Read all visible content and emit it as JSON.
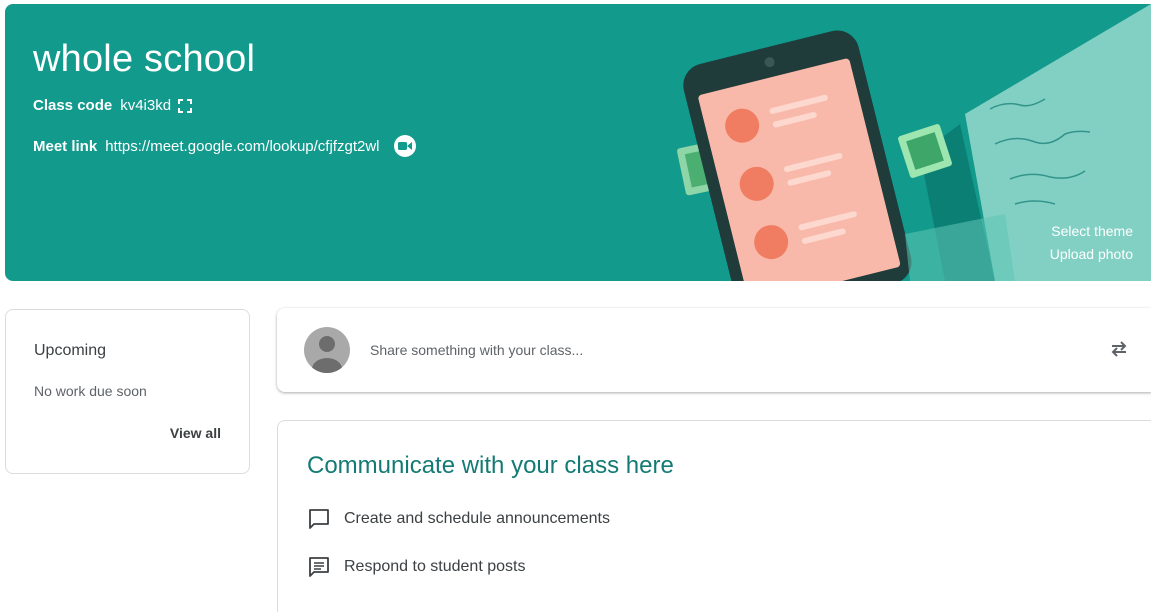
{
  "banner": {
    "title": "whole school",
    "class_code_label": "Class code",
    "class_code_value": "kv4i3kd",
    "meet_link_label": "Meet link",
    "meet_link_value": "https://meet.google.com/lookup/cfjfzgt2wl",
    "select_theme": "Select theme",
    "upload_photo": "Upload photo",
    "color": "#129a8d"
  },
  "upcoming": {
    "title": "Upcoming",
    "empty_text": "No work due soon",
    "view_all": "View all"
  },
  "share": {
    "placeholder": "Share something with your class..."
  },
  "communicate": {
    "heading": "Communicate with your class here",
    "items": [
      {
        "icon": "announcement-icon",
        "label": "Create and schedule announcements"
      },
      {
        "icon": "posts-icon",
        "label": "Respond to student posts"
      }
    ],
    "heading_color": "#137b74"
  }
}
